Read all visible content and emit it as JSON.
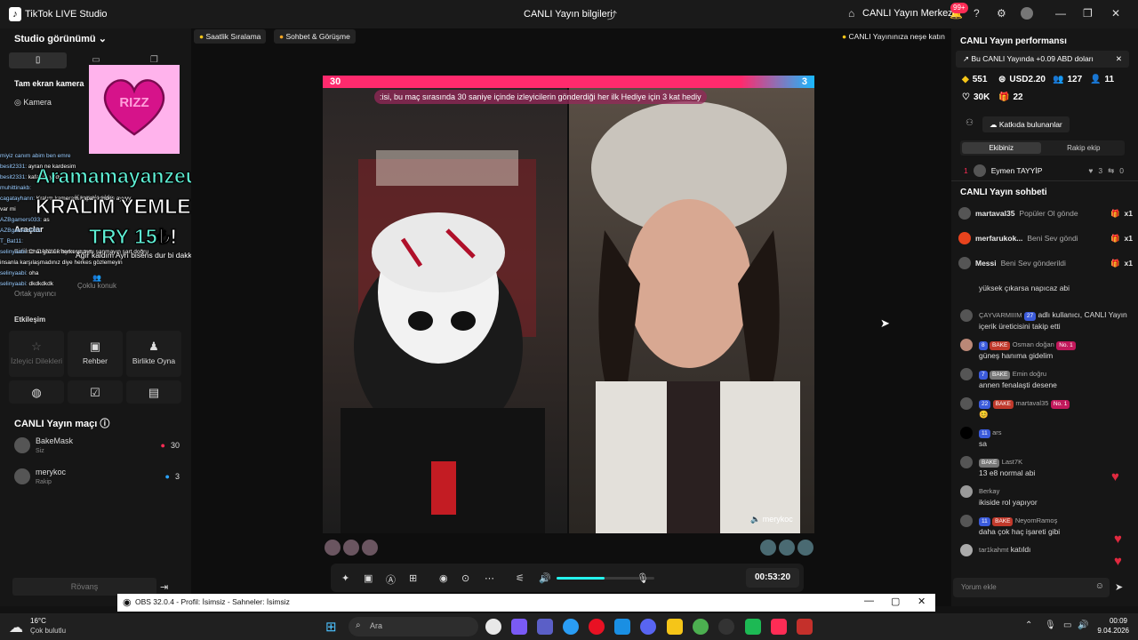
{
  "titlebar": {
    "app_title": "TikTok LIVE Studio",
    "center_title": "CANLI Yayın bilgileri",
    "merkez": "CANLI Yayın Merkezi",
    "notif_badge": "99+"
  },
  "left": {
    "studio_view": "Studio görünümü",
    "fullscreen_camera": "Tam ekran kamera",
    "camera": "Kamera",
    "add_source": "Kaynak ekle",
    "tools": "Araçlar",
    "live_match_label": "Birlikte CANLI Yayın yapın",
    "multi_guest": "Çoklu konuk",
    "guest_stream": "Ortak yayıncı",
    "interaction": "Etkileşim",
    "cards": [
      {
        "label": "İzleyici Dilekleri",
        "icon": "viewer-wish-icon"
      },
      {
        "label": "Rehber",
        "icon": "guide-icon"
      },
      {
        "label": "Birlikte Oyna",
        "icon": "play-together-icon"
      }
    ],
    "match_title": "CANLI Yayın maçı",
    "players": [
      {
        "name": "BakeMask",
        "sub": "Siz",
        "score": "30"
      },
      {
        "name": "merykoc",
        "sub": "Rakip",
        "score": "3"
      }
    ],
    "rematch": "Rövanş"
  },
  "overlay": {
    "rizz": "RIZZ",
    "line1": "Aramamayanzeuss",
    "line2": "KRALIM YEMLEDİ",
    "line3": "TRY 15",
    "tts": "Ağır kaldım  Ayrı bisens dur bi dakka yanlış oldu",
    "chat": [
      {
        "u": "miyiz canım abim ben emre",
        "t": ""
      },
      {
        "u": "besit2331:",
        "t": " ayran ne kardesim"
      },
      {
        "u": "besit2331:",
        "t": " kafasini yedi"
      },
      {
        "u": "muhittinakb:",
        "t": " "
      },
      {
        "u": "cagatayhann:",
        "t": " Kralım kameram kapalı kardeş ayyyy"
      },
      {
        "u": "",
        "t": "var mi"
      },
      {
        "u": "AZBgamers033:",
        "t": " as"
      },
      {
        "u": "AZBgamers033:",
        "t": " "
      },
      {
        "u": "T_Bat11:",
        "t": ""
      },
      {
        "u": "selinyaabi:",
        "t": " Chat gözlük herkese aynı sanmayın şart doğru"
      },
      {
        "u": "",
        "t": "insanla karşılaşmadınız diye herkes gözlemeyin"
      },
      {
        "u": "selinyaabi:",
        "t": " oha"
      },
      {
        "u": "selinyaabi:",
        "t": " dkdkdkdk"
      }
    ]
  },
  "stage": {
    "pill_hourly": "Saatlik Sıralama",
    "pill_chat": "Sohbet & Görüşme",
    "pill_right": "CANLI Yayınınıza neşe katın",
    "score_left": "30",
    "score_right": "3",
    "banner": ":isi, bu maç sırasında 30 saniye içinde izleyicilerin gönderdiği her ilk Hediye için 3 kat hediy",
    "opponent_name": "merykoc",
    "timer": "00:53:20"
  },
  "right": {
    "performance": "CANLI Yayın performansı",
    "earn_note": "Bu CANLI Yayında +0.09 ABD doları",
    "stats": [
      {
        "icon": "diamond-icon",
        "value": "551"
      },
      {
        "icon": "usd-icon",
        "value": "USD2.20"
      },
      {
        "icon": "viewers-icon",
        "value": "127"
      },
      {
        "icon": "followers-icon",
        "value": "11"
      },
      {
        "icon": "heart-icon",
        "value": "30K"
      },
      {
        "icon": "gift-icon",
        "value": "22"
      }
    ],
    "contributors": "Katkıda bulunanlar",
    "tab_ours": "Ekibiniz",
    "tab_rival": "Rakip ekip",
    "top_contributor": "Eymen TAYYİP",
    "top_rank": "1",
    "top_likes": "3",
    "top_shares": "0",
    "chat_title": "CANLI Yayın sohbeti",
    "gifts": [
      {
        "user": "martaval35",
        "text": "Popüler Ol gönde",
        "count": "x1"
      },
      {
        "user": "merfarukok...",
        "text": "Beni Sev göndi",
        "count": "x1"
      },
      {
        "user": "Messi",
        "text": "Beni Sev gönderildi",
        "count": "x1"
      }
    ],
    "comments": [
      {
        "name": "",
        "level": "",
        "fan": "",
        "msg": "yüksek çıkarsa napıcaz abi"
      },
      {
        "name": "ÇAYVARMIIIM",
        "level": "27",
        "fan": "",
        "msg": "adlı kullanıcı, CANLI Yayın içerik üreticisini takip etti"
      },
      {
        "name": "Osman doğan",
        "level": "8",
        "fan": "BAKE",
        "msg": "güneş hanıma gidelim"
      },
      {
        "name": "Emin doğru",
        "level": "7",
        "fan": "BAKE",
        "msg": "annen fenalaşti desene"
      },
      {
        "name": "martaval35",
        "level": "22",
        "fan": "BAKE",
        "msg": ""
      },
      {
        "name": "ars",
        "level": "11",
        "fan": "",
        "msg": "sa"
      },
      {
        "name": "Last7K",
        "level": "",
        "fan": "BAKE",
        "msg": "13 e8 normal abi"
      },
      {
        "name": "Berkay",
        "level": "",
        "fan": "",
        "msg": "ikiside rol yapıyor"
      },
      {
        "name": "NeyomRamoş",
        "level": "11",
        "fan": "BAKE",
        "msg": "daha çok haç işareti gibi"
      },
      {
        "name": "tar1kahmt",
        "level": "",
        "fan": "",
        "msg": "katıldı"
      }
    ],
    "no1": "No. 1",
    "comment_placeholder": "Yorum ekle"
  },
  "obs": {
    "title": "OBS 32.0.4 - Profil: İsimsiz - Sahneler: İsimsiz"
  },
  "taskbar": {
    "temp": "16°C",
    "weather": "Çok bulutlu",
    "search_placeholder": "Ara",
    "time": "00:09",
    "date": "9.04.2026"
  },
  "colors": {
    "accent": "#fe2c55",
    "teal": "#25f4ee",
    "panel": "#161616"
  }
}
